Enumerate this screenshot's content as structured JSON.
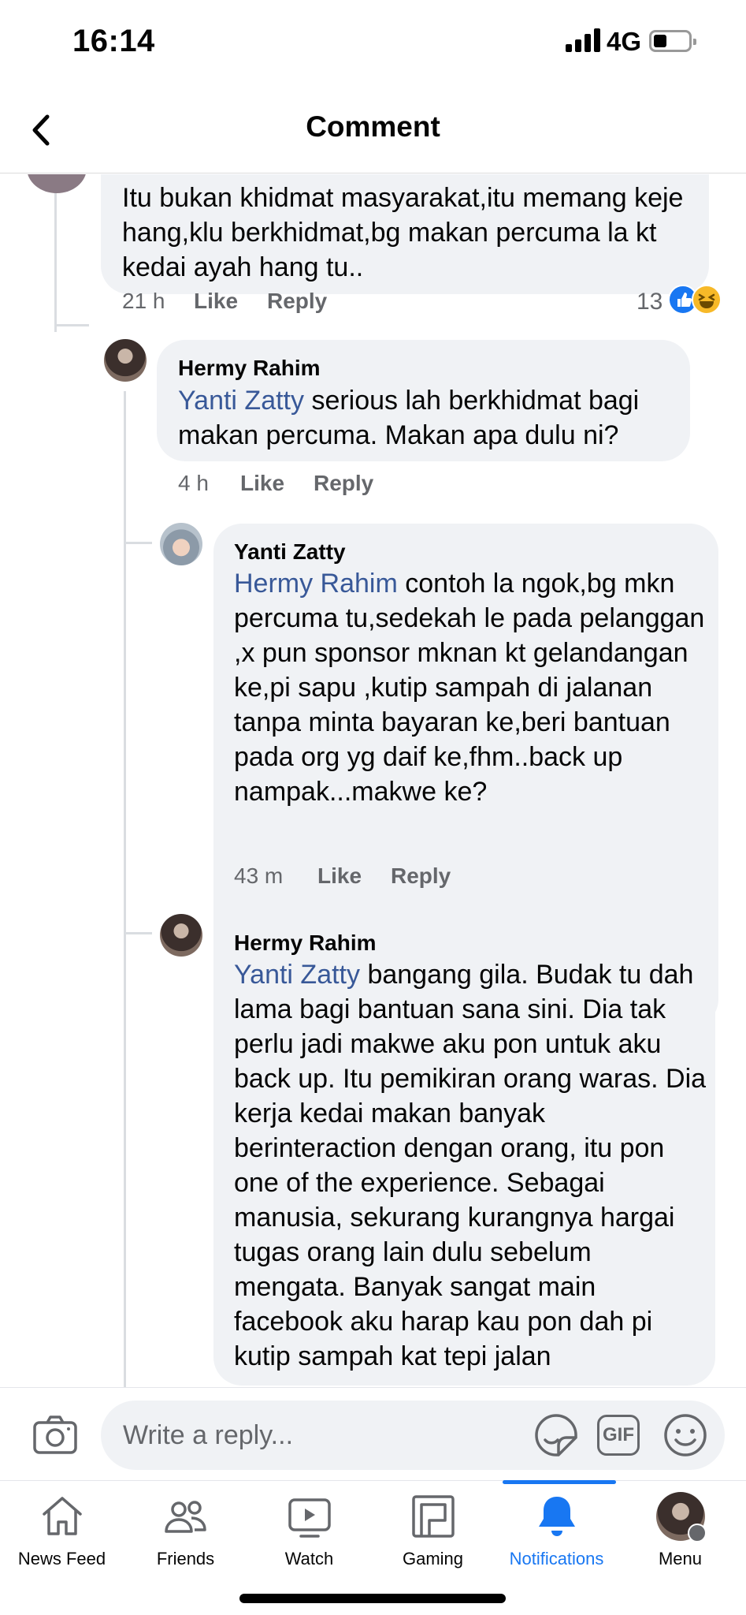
{
  "status_bar": {
    "time": "16:14",
    "network": "4G"
  },
  "header": {
    "title": "Comment"
  },
  "comments": [
    {
      "name": "",
      "text": "Itu bukan khidmat masyarakat,itu memang keje hang,klu berkhidmat,bg makan percuma la kt kedai ayah hang tu..",
      "time": "21 h",
      "like_label": "Like",
      "reply_label": "Reply",
      "reaction_count": "13"
    },
    {
      "name": "Hermy Rahim",
      "mention": "Yanti Zatty",
      "text": "serious lah berkhidmat bagi makan percuma. Makan apa dulu ni?",
      "time": "4 h",
      "like_label": "Like",
      "reply_label": "Reply"
    },
    {
      "name": "Yanti Zatty",
      "mention": "Hermy Rahim",
      "text": "contoh la ngok,bg mkn percuma tu,sedekah le pada pelanggan ,x pun  sponsor mknan kt gelandangan ke,pi sapu ,kutip sampah di jalanan tanpa minta bayaran ke,beri bantuan pada org yg daif ke,fhm..back up nampak...makwe ke?",
      "time": "43 m",
      "like_label": "Like",
      "reply_label": "Reply"
    },
    {
      "name": "Hermy Rahim",
      "mention": "Yanti Zatty",
      "text": "bangang gila. Budak tu dah lama bagi bantuan sana sini. Dia tak perlu jadi makwe aku pon untuk aku back up. Itu pemikiran orang waras. Dia kerja kedai makan banyak berinteraction dengan orang, itu pon one of the experience. Sebagai manusia, sekurang kurangnya hargai tugas orang lain dulu sebelum mengata. Banyak sangat main facebook aku harap kau pon dah pi kutip sampah kat tepi jalan"
    }
  ],
  "composer": {
    "placeholder": "Write a reply...",
    "gif_label": "GIF"
  },
  "nav": {
    "items": [
      {
        "label": "News Feed",
        "icon": "home-icon"
      },
      {
        "label": "Friends",
        "icon": "friends-icon"
      },
      {
        "label": "Watch",
        "icon": "watch-icon"
      },
      {
        "label": "Gaming",
        "icon": "gaming-icon"
      },
      {
        "label": "Notifications",
        "icon": "bell-icon",
        "active": true
      },
      {
        "label": "Menu",
        "icon": "profile-avatar"
      }
    ]
  },
  "colors": {
    "accent": "#1877f2",
    "mention": "#385898",
    "bubble": "#f0f2f5",
    "muted": "#65676b"
  }
}
